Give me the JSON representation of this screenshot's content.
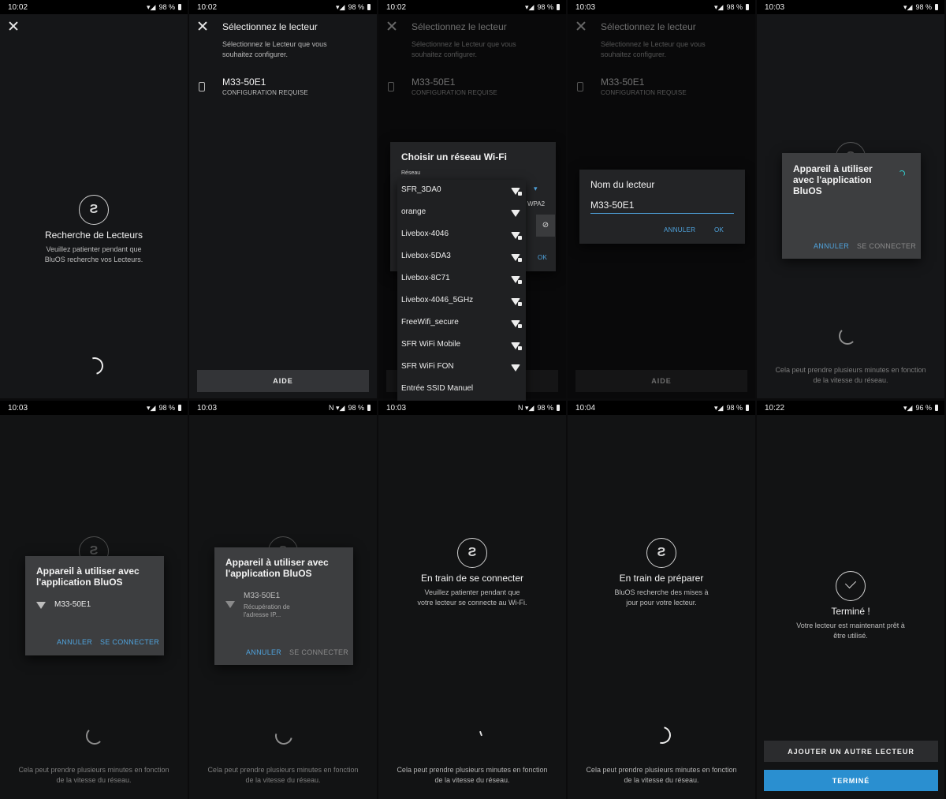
{
  "statusbars": [
    {
      "time": "10:02",
      "battery": "98 %"
    },
    {
      "time": "10:02",
      "battery": "98 %"
    },
    {
      "time": "10:02",
      "battery": "98 %"
    },
    {
      "time": "10:03",
      "battery": "98 %"
    },
    {
      "time": "10:03",
      "battery": "98 %"
    },
    {
      "time": "10:03",
      "battery": "98 %"
    },
    {
      "time": "10:03",
      "battery": "98 %"
    },
    {
      "time": "10:03",
      "battery": "98 %"
    },
    {
      "time": "10:04",
      "battery": "98 %"
    },
    {
      "time": "10:22",
      "battery": "96 %"
    }
  ],
  "search": {
    "title": "Recherche de Lecteurs",
    "subtitle": "Veuillez patienter pendant que BluOS recherche vos Lecteurs."
  },
  "select": {
    "title": "Sélectionnez le lecteur",
    "subtitle": "Sélectionnez le Lecteur que vous souhaitez configurer.",
    "player_name": "M33-50E1",
    "player_status": "CONFIGURATION REQUISE",
    "help_button": "AIDE"
  },
  "wifi_dialog": {
    "title": "Choisir un réseau Wi-Fi",
    "network_label": "Réseau",
    "security_hint": "WPA2",
    "ok_partial": "OK",
    "networks": [
      {
        "ssid": "SFR_3DA0",
        "locked": true
      },
      {
        "ssid": "orange",
        "locked": false
      },
      {
        "ssid": "Livebox-4046",
        "locked": true
      },
      {
        "ssid": "Livebox-5DA3",
        "locked": true
      },
      {
        "ssid": "Livebox-8C71",
        "locked": true
      },
      {
        "ssid": "Livebox-4046_5GHz",
        "locked": true
      },
      {
        "ssid": "FreeWifi_secure",
        "locked": true
      },
      {
        "ssid": "SFR WiFi Mobile",
        "locked": true
      },
      {
        "ssid": "SFR WiFi FON",
        "locked": false
      },
      {
        "ssid": "Entrée SSID Manuel",
        "locked": false
      }
    ]
  },
  "name_dialog": {
    "title": "Nom du lecteur",
    "value": "M33-50E1",
    "cancel": "ANNULER",
    "ok": "OK"
  },
  "pair_dialog": {
    "title": "Appareil à utiliser avec l'application BluOS",
    "cancel": "ANNULER",
    "connect": "SE CONNECTER",
    "device": "M33-50E1",
    "device_status": "Récupération de l'adresse IP..."
  },
  "footnote": "Cela peut prendre plusieurs minutes en fonction de la vitesse du réseau.",
  "connecting": {
    "title": "En train de se connecter",
    "subtitle": "Veuillez patienter pendant que votre lecteur se connecte au Wi-Fi."
  },
  "preparing": {
    "title": "En train de préparer",
    "subtitle": "BluOS recherche des mises à jour pour votre lecteur."
  },
  "done": {
    "title": "Terminé !",
    "subtitle": "Votre lecteur est maintenant prêt à être utilisé.",
    "add_button": "AJOUTER UN AUTRE LECTEUR",
    "done_button": "TERMINÉ"
  },
  "colors": {
    "accent": "#4fa3dd",
    "primary_button": "#2a8fd0",
    "background": "#151618"
  }
}
